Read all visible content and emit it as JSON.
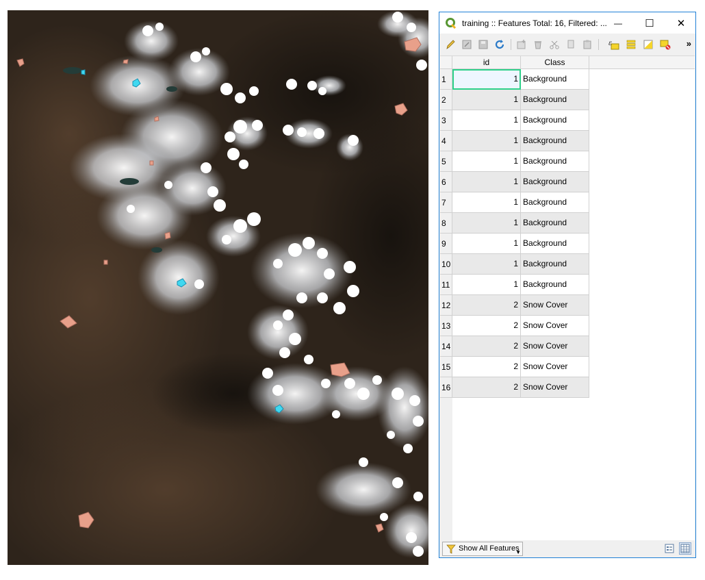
{
  "window": {
    "title": "training :: Features Total: 16, Filtered: ...",
    "minimize_glyph": "—",
    "maximize_glyph": "☐",
    "close_glyph": "✕",
    "more_glyph": "»"
  },
  "toolbar": {
    "icons": [
      "toggle-edit-icon",
      "multi-edit-icon",
      "save-edits-icon",
      "reload-icon",
      "add-feature-icon",
      "delete-feature-icon",
      "cut-icon",
      "copy-icon",
      "paste-icon",
      "expression-select-icon",
      "select-all-icon",
      "invert-selection-icon",
      "deselect-all-icon"
    ]
  },
  "table": {
    "columns": [
      "id",
      "Class"
    ],
    "rows": [
      {
        "num": "1",
        "id": "1",
        "class": "Background"
      },
      {
        "num": "2",
        "id": "1",
        "class": "Background"
      },
      {
        "num": "3",
        "id": "1",
        "class": "Background"
      },
      {
        "num": "4",
        "id": "1",
        "class": "Background"
      },
      {
        "num": "5",
        "id": "1",
        "class": "Background"
      },
      {
        "num": "6",
        "id": "1",
        "class": "Background"
      },
      {
        "num": "7",
        "id": "1",
        "class": "Background"
      },
      {
        "num": "8",
        "id": "1",
        "class": "Background"
      },
      {
        "num": "9",
        "id": "1",
        "class": "Background"
      },
      {
        "num": "10",
        "id": "1",
        "class": "Background"
      },
      {
        "num": "11",
        "id": "1",
        "class": "Background"
      },
      {
        "num": "12",
        "id": "2",
        "class": "Snow Cover"
      },
      {
        "num": "13",
        "id": "2",
        "class": "Snow Cover"
      },
      {
        "num": "14",
        "id": "2",
        "class": "Snow Cover"
      },
      {
        "num": "15",
        "id": "2",
        "class": "Snow Cover"
      },
      {
        "num": "16",
        "id": "2",
        "class": "Snow Cover"
      }
    ]
  },
  "bottom": {
    "filter_label": "Show All Features"
  },
  "colors": {
    "background_polygon": "#e8a08a",
    "snow_polygon": "#40d8f0",
    "current_cell": "#2ed08a",
    "window_border": "#1e7fd6"
  }
}
